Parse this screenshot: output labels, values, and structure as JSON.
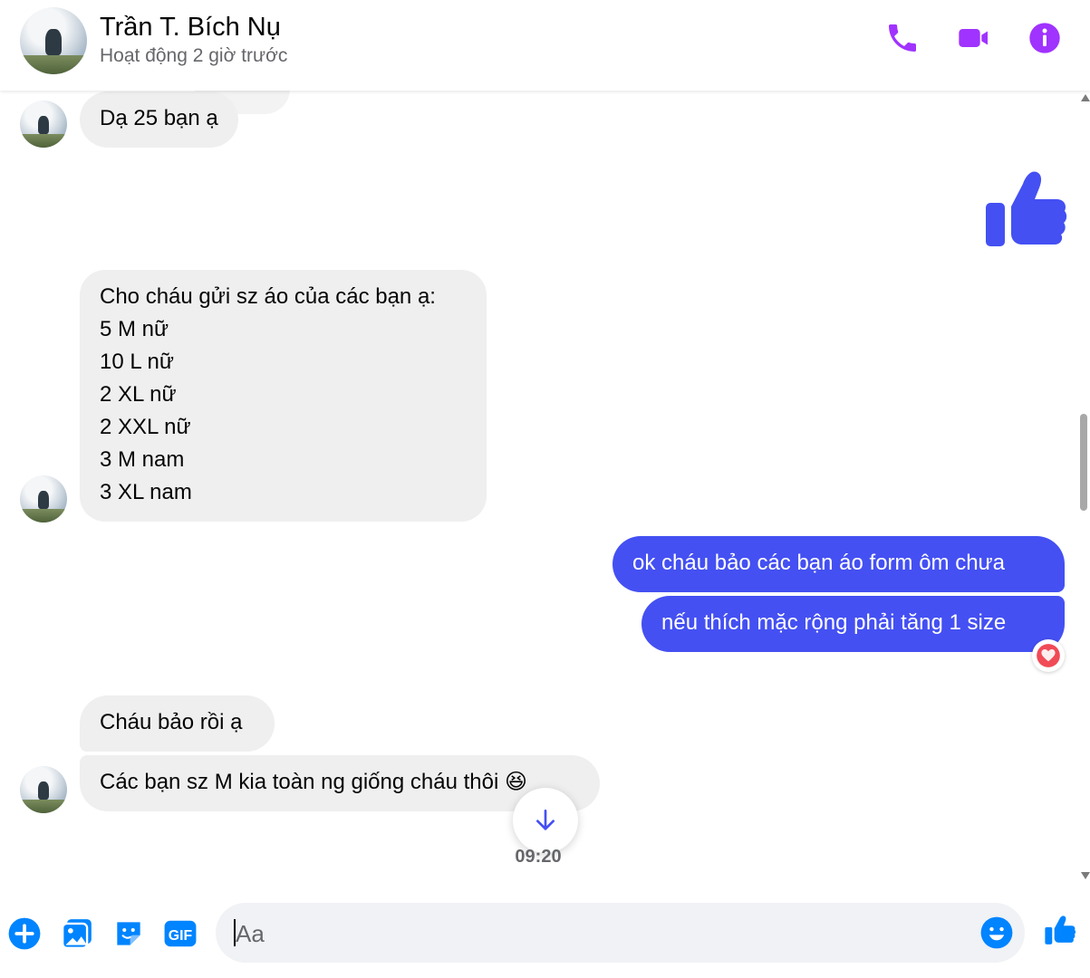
{
  "header": {
    "contact_name": "Trần T. Bích Nụ",
    "status": "Hoạt động 2 giờ trước",
    "icons": [
      "phone-icon",
      "video-call-icon",
      "info-icon"
    ]
  },
  "messages": [
    {
      "side": "in",
      "text": "Dạ 25 bạn ạ"
    },
    {
      "side": "out",
      "type": "like-sticker"
    },
    {
      "side": "in",
      "text": "Cho cháu gửi sz áo của các bạn ạ:\n5 M nữ\n10 L nữ\n2 XL nữ\n2 XXL nữ\n3 M nam\n3 XL nam"
    },
    {
      "side": "out",
      "text": "ok cháu bảo các bạn áo form ôm chưa"
    },
    {
      "side": "out",
      "text": "nếu thích mặc rộng phải tăng 1 size",
      "reaction": "heart"
    },
    {
      "side": "in",
      "text": "Cháu bảo rồi ạ"
    },
    {
      "side": "in",
      "text": "Các bạn sz M kia toàn ng giống cháu thôi 😆"
    }
  ],
  "timestamp": "09:20",
  "composer": {
    "placeholder": "Aa",
    "icons": [
      "plus-icon",
      "photo-icon",
      "sticker-icon",
      "gif-icon",
      "emoji-icon",
      "thumbs-up-icon"
    ],
    "gif_label": "GIF"
  },
  "colors": {
    "accent": "#a033ff",
    "outgoing_bubble": "#4450f2",
    "incoming_bubble": "#efefef",
    "composer_icon": "#0084ff"
  }
}
